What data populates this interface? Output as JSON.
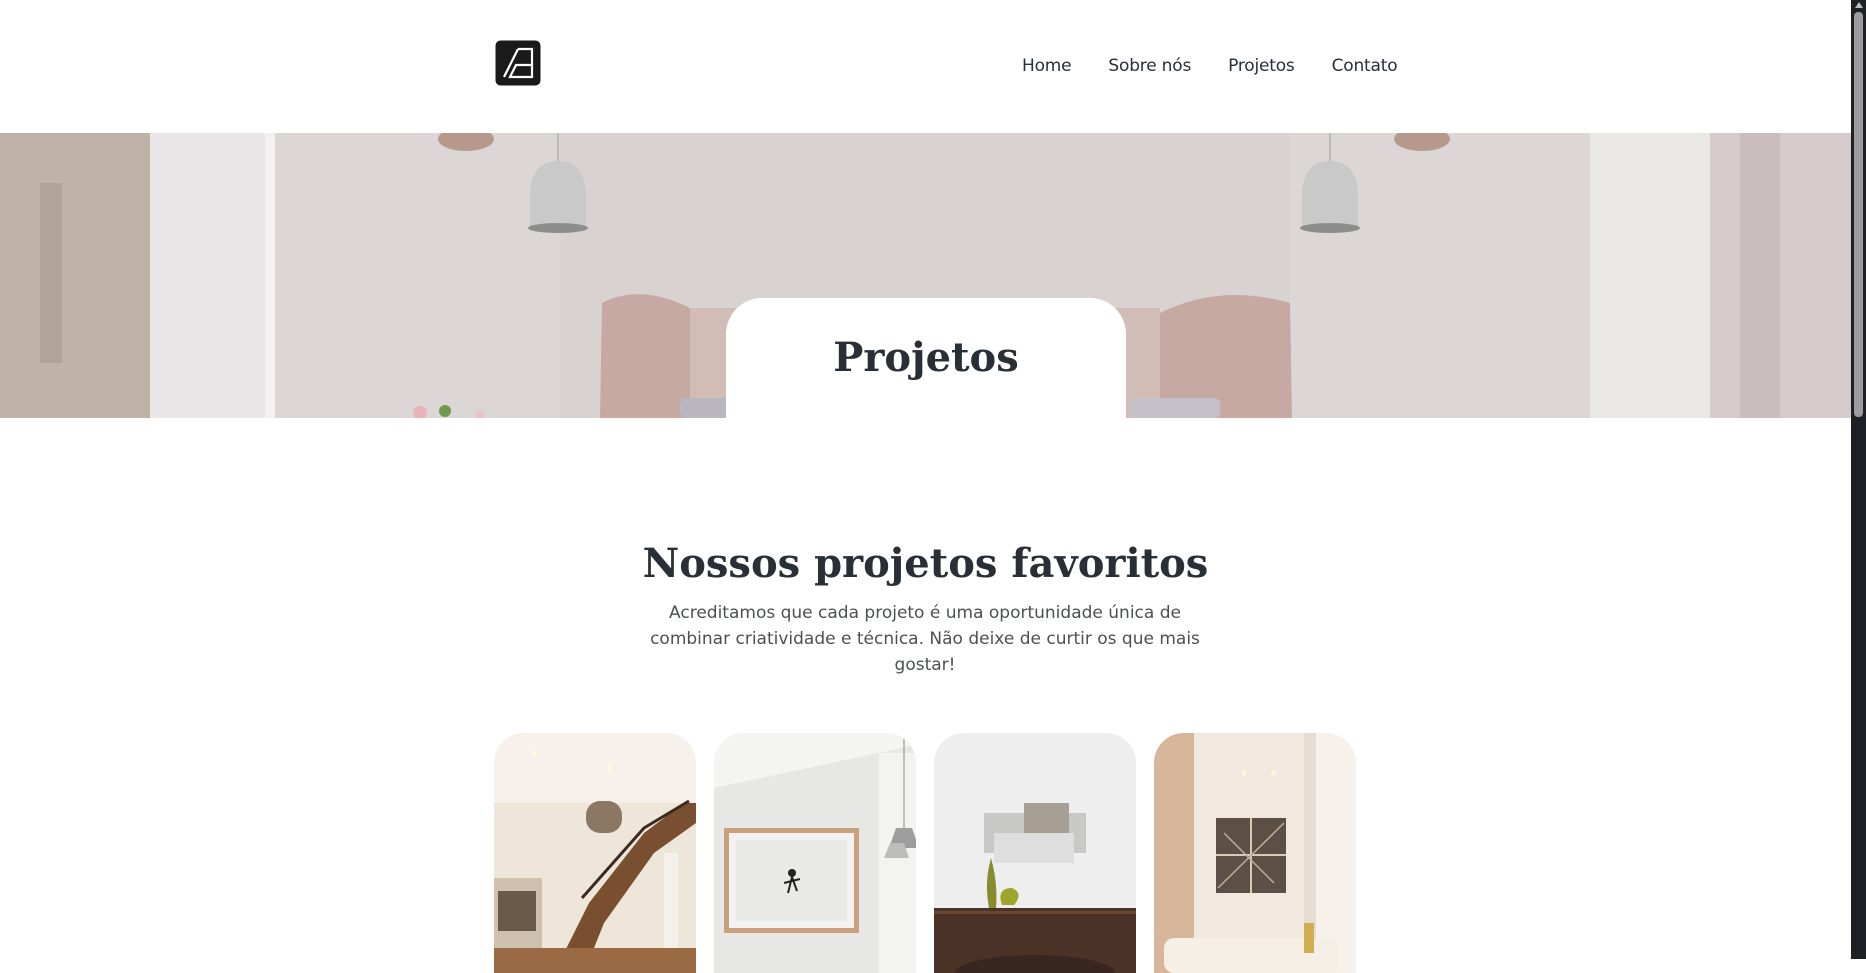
{
  "header": {
    "logo": "architecture-logo-icon",
    "nav": [
      {
        "label": "Home"
      },
      {
        "label": "Sobre nós"
      },
      {
        "label": "Projetos"
      },
      {
        "label": "Contato"
      }
    ]
  },
  "hero": {
    "title": "Projetos"
  },
  "section": {
    "title": "Nossos projetos favoritos",
    "text": "Acreditamos que cada projeto é uma oportunidade única de combinar criatividade e técnica. Não deixe de curtir os que mais gostar!"
  },
  "projects": [
    {
      "image": "staircase-interior-photo"
    },
    {
      "image": "wall-art-interior-photo"
    },
    {
      "image": "sideboard-interior-photo"
    },
    {
      "image": "living-room-interior-photo"
    }
  ],
  "colors": {
    "text_dark": "#292f36",
    "text_body": "#4d5053",
    "background": "#ffffff"
  }
}
